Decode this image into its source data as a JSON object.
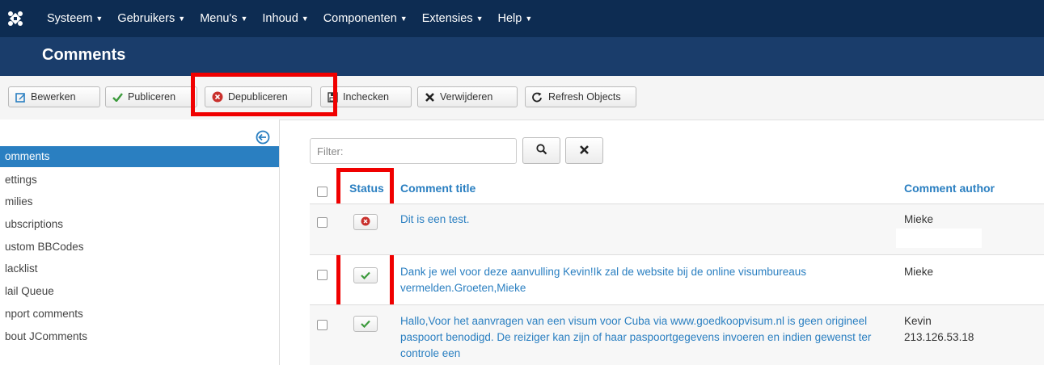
{
  "topbar": {
    "menu": [
      {
        "label": "Systeem"
      },
      {
        "label": "Gebruikers"
      },
      {
        "label": "Menu's"
      },
      {
        "label": "Inhoud"
      },
      {
        "label": "Componenten"
      },
      {
        "label": "Extensies"
      },
      {
        "label": "Help"
      }
    ]
  },
  "header": {
    "title": "Comments"
  },
  "toolbar": {
    "edit_label": "Bewerken",
    "publish_label": "Publiceren",
    "unpublish_label": "Depubliceren",
    "checkin_label": "Inchecken",
    "delete_label": "Verwijderen",
    "refresh_label": "Refresh Objects"
  },
  "sidebar": {
    "items": [
      {
        "label": "omments"
      },
      {
        "label": "ettings"
      },
      {
        "label": "milies"
      },
      {
        "label": "ubscriptions"
      },
      {
        "label": "ustom BBCodes"
      },
      {
        "label": "lacklist"
      },
      {
        "label": "lail Queue"
      },
      {
        "label": "nport comments"
      },
      {
        "label": "bout JComments"
      }
    ]
  },
  "filter": {
    "placeholder": "Filter:"
  },
  "table": {
    "headers": {
      "status": "Status",
      "title": "Comment title",
      "author": "Comment author"
    },
    "rows": [
      {
        "status": "unpublished",
        "title": "Dit is een test.",
        "author": "Mieke",
        "ip": ""
      },
      {
        "status": "published",
        "title": "Dank je wel voor deze aanvulling Kevin!Ik zal de website bij de online visumbureaus vermelden.Groeten,Mieke",
        "author": "Mieke",
        "ip": ""
      },
      {
        "status": "published",
        "title": "Hallo,Voor het aanvragen van een visum voor Cuba via www.goedkoopvisum.nl is geen origineel paspoort benodigd. De reiziger kan zijn of haar paspoortgegevens invoeren en indien gewenst ter controle een",
        "author": "Kevin",
        "ip": "213.126.53.18"
      }
    ]
  },
  "colors": {
    "navbar": "#0d2c52",
    "header": "#1a3d6b",
    "accent": "#2a7fc1",
    "highlight_box": "#f00000",
    "publish_green": "#3c9a3c",
    "unpublish_red": "#c9302c"
  }
}
